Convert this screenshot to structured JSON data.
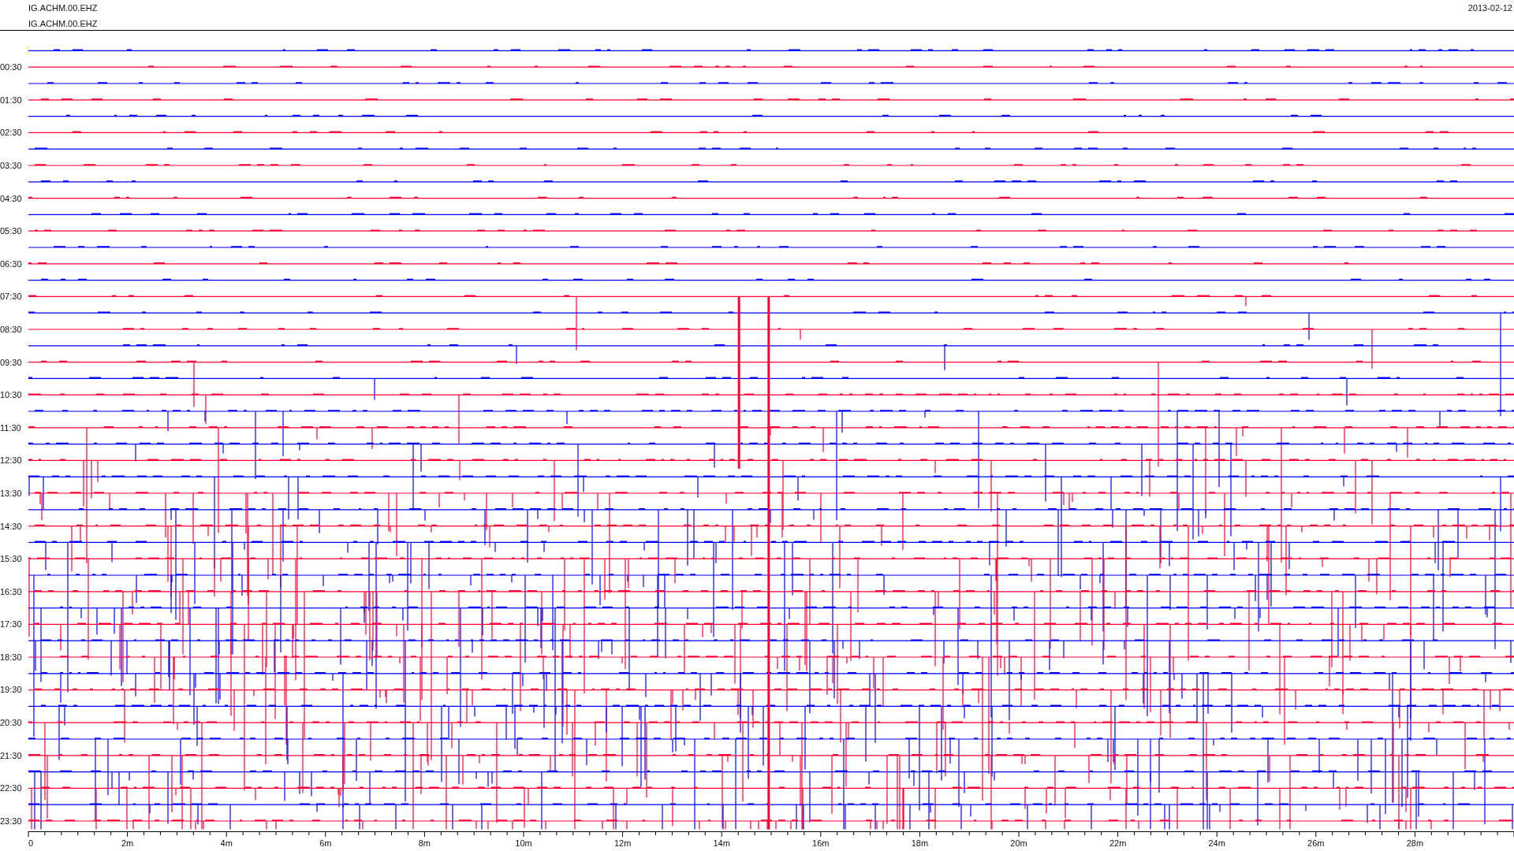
{
  "header": {
    "station_lines": [
      "IG.ACHM.00.EHZ",
      "IG.ACHM.00.EHZ"
    ],
    "date": "2013-02-12"
  },
  "hour_labels": [
    "00:30",
    "01:30",
    "02:30",
    "03:30",
    "04:30",
    "05:30",
    "06:30",
    "07:30",
    "08:30",
    "09:30",
    "10:30",
    "11:30",
    "12:30",
    "13:30",
    "14:30",
    "15:30",
    "16:30",
    "17:30",
    "18:30",
    "19:30",
    "20:30",
    "21:30",
    "22:30",
    "23:30"
  ],
  "x_axis": {
    "tick_labels": [
      "0",
      "2m",
      "4m",
      "6m",
      "8m",
      "10m",
      "12m",
      "14m",
      "16m",
      "18m",
      "20m",
      "22m",
      "24m",
      "26m",
      "28m"
    ]
  }
}
